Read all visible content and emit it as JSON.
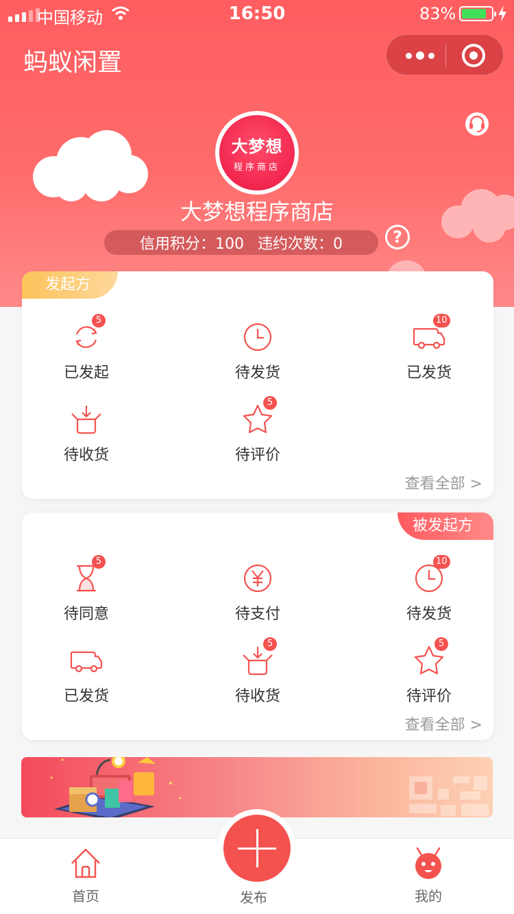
{
  "status_bar": {
    "carrier": "中国移动",
    "time": "16:50",
    "battery_percent": "83%",
    "battery_level": 0.83
  },
  "nav": {
    "title": "蚂蚁闲置",
    "more_icon": "more-dots-icon",
    "close_icon": "target-circle-icon"
  },
  "profile": {
    "avatar_line1": "大梦想",
    "avatar_line2": "程序商店",
    "shop_name": "大梦想程序商店",
    "credit_label": "信用积分：100",
    "violation_label": "违约次数：0",
    "help_glyph": "?"
  },
  "initiator_card": {
    "tag": "发起方",
    "items": [
      {
        "label": "已发起",
        "icon": "refresh-icon",
        "badge": "5"
      },
      {
        "label": "待发货",
        "icon": "clock-icon",
        "badge": ""
      },
      {
        "label": "已发货",
        "icon": "truck-icon",
        "badge": "10"
      },
      {
        "label": "待收货",
        "icon": "receive-box-icon",
        "badge": ""
      },
      {
        "label": "待评价",
        "icon": "star-icon",
        "badge": "5"
      }
    ],
    "view_all": "查看全部 >"
  },
  "receiver_card": {
    "tag": "被发起方",
    "items": [
      {
        "label": "待同意",
        "icon": "hourglass-icon",
        "badge": "5"
      },
      {
        "label": "待支付",
        "icon": "yen-icon",
        "badge": ""
      },
      {
        "label": "待发货",
        "icon": "clock-icon",
        "badge": "10"
      },
      {
        "label": "已发货",
        "icon": "truck-icon",
        "badge": ""
      },
      {
        "label": "待收货",
        "icon": "receive-box-icon",
        "badge": "5"
      },
      {
        "label": "待评价",
        "icon": "star-icon",
        "badge": "5"
      }
    ],
    "view_all": "查看全部 >"
  },
  "tabbar": {
    "home": "首页",
    "publish": "发布",
    "mine": "我的"
  },
  "colors": {
    "accent": "#f4524f",
    "header_top": "#ff5d60",
    "tag_initiator": "#fcc35a",
    "tag_receiver": "#ff5a5f"
  }
}
